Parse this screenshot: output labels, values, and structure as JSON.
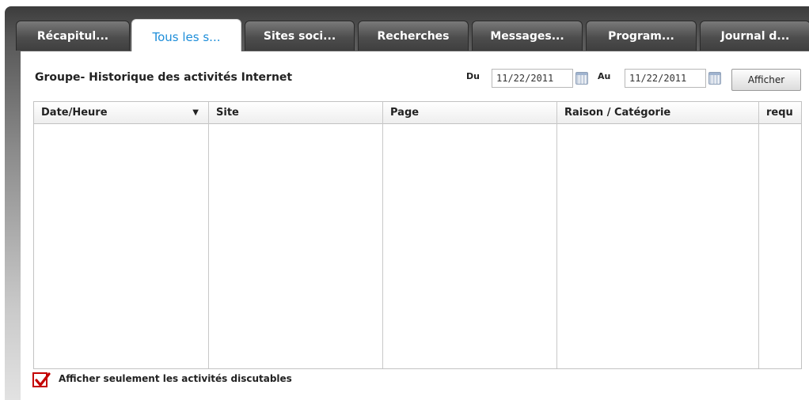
{
  "tabs": [
    {
      "label": "Récapitul...",
      "active": false
    },
    {
      "label": "Tous les s...",
      "active": true
    },
    {
      "label": "Sites soci...",
      "active": false
    },
    {
      "label": "Recherches",
      "active": false
    },
    {
      "label": "Messages...",
      "active": false
    },
    {
      "label": "Program...",
      "active": false
    },
    {
      "label": "Journal d...",
      "active": false
    }
  ],
  "panel": {
    "title": "Groupe- Historique des activités Internet",
    "date_from": {
      "label": "Du",
      "value": "11/22/2011",
      "icon": "calendar-icon"
    },
    "date_to": {
      "label": "Au",
      "value": "11/22/2011",
      "icon": "calendar-icon"
    },
    "show_button": "Afficher"
  },
  "table": {
    "columns": [
      {
        "label": "Date/Heure",
        "sorted": "descending",
        "sort_icon": "▼"
      },
      {
        "label": "Site"
      },
      {
        "label": "Page"
      },
      {
        "label": "Raison / Catégorie"
      },
      {
        "label": "requ"
      }
    ],
    "rows": []
  },
  "filter": {
    "checked": true,
    "label": "Afficher seulement les activités discutables"
  },
  "colors": {
    "active_tab_text": "#1e8ed9",
    "checkbox_accent": "#c40000"
  }
}
